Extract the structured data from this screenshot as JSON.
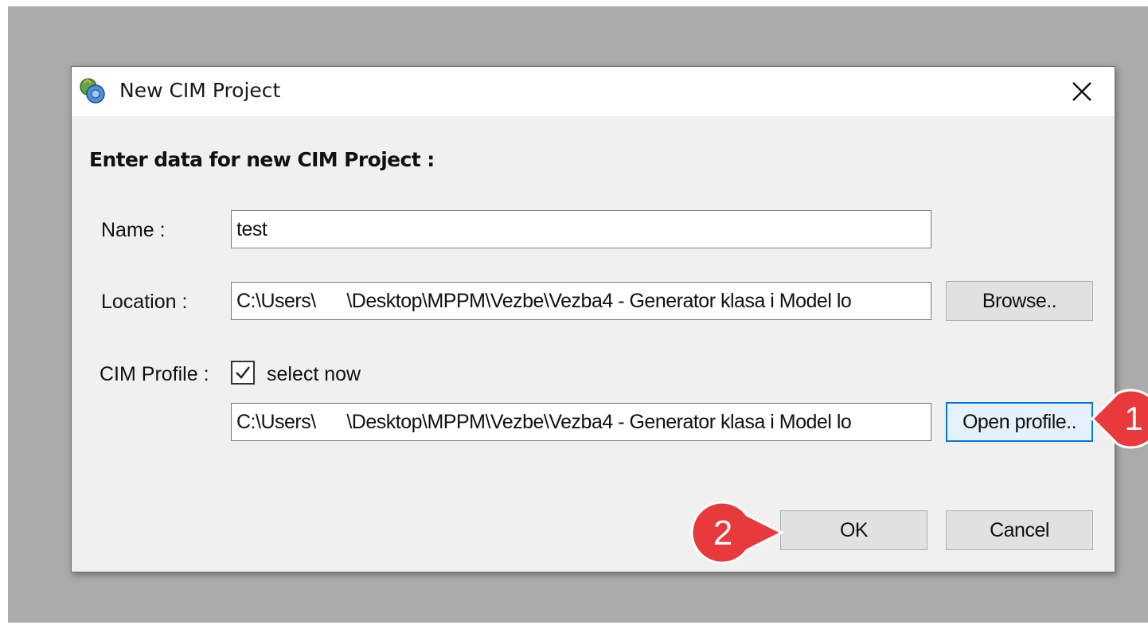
{
  "dialog": {
    "title": "New CIM Project",
    "heading": "Enter data for new CIM Project :",
    "name": {
      "label": "Name :",
      "value": "test"
    },
    "location": {
      "label": "Location :",
      "value": "C:\\Users\\      \\Desktop\\MPPM\\Vezbe\\Vezba4 - Generator klasa i Model lo",
      "browse_label": "Browse.."
    },
    "cim_profile": {
      "label": "CIM Profile :",
      "checkbox_label": "select now",
      "checked": true,
      "value": "C:\\Users\\      \\Desktop\\MPPM\\Vezbe\\Vezba4 - Generator klasa i Model lo",
      "open_label": "Open profile.."
    },
    "ok_label": "OK",
    "cancel_label": "Cancel"
  },
  "annotations": {
    "step1": "1",
    "step2": "2",
    "color": "#e8393d"
  },
  "icons": {
    "app": "cim-project-icon",
    "close": "close-icon",
    "check": "checkmark-icon"
  }
}
